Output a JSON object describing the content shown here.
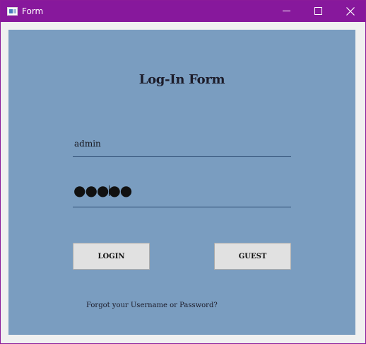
{
  "window": {
    "title": "Form",
    "titlebar_color": "#87189c"
  },
  "form": {
    "heading": "Log-In Form",
    "username_value": "admin",
    "password_mask": "●●●●●",
    "login_label": "LOGIN",
    "guest_label": "GUEST",
    "forgot_link": "Forgot your Username or Password?",
    "panel_color": "#7a9dc0"
  },
  "icons": {
    "app": "window-app-icon",
    "minimize": "minimize-icon",
    "maximize": "maximize-icon",
    "close": "close-icon"
  }
}
